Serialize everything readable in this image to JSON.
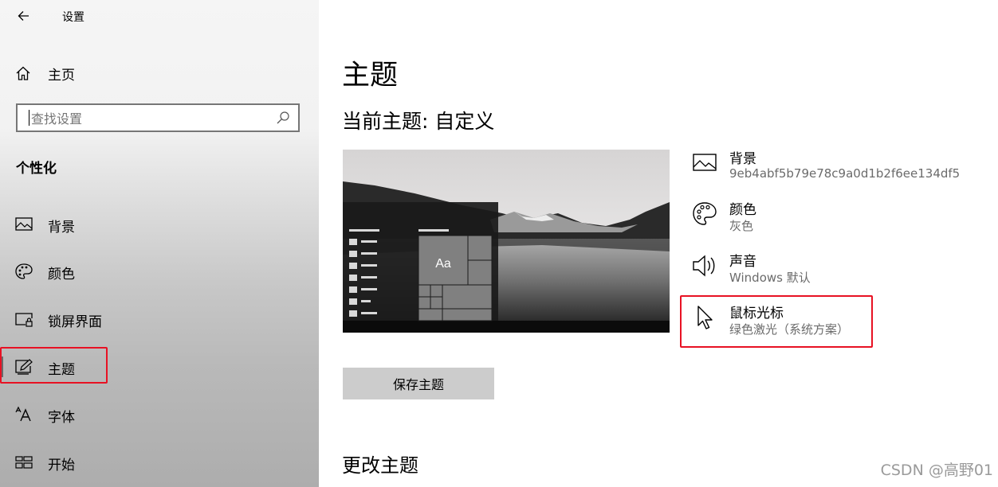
{
  "window": {
    "title": "设置"
  },
  "sidebar": {
    "home_label": "主页",
    "search_placeholder": "查找设置",
    "section_title": "个性化",
    "items": [
      {
        "label": "背景",
        "icon": "picture-icon"
      },
      {
        "label": "颜色",
        "icon": "palette-icon"
      },
      {
        "label": "锁屏界面",
        "icon": "lock-screen-icon"
      },
      {
        "label": "主题",
        "icon": "theme-icon",
        "selected": true
      },
      {
        "label": "字体",
        "icon": "font-icon"
      },
      {
        "label": "开始",
        "icon": "start-icon"
      }
    ]
  },
  "main": {
    "title": "主题",
    "current_theme": "当前主题: 自定义",
    "preview_tile_text": "Aa",
    "options": [
      {
        "title": "背景",
        "value": "9eb4abf5b79e78c9a0d1b2f6ee134df5",
        "icon": "picture-icon"
      },
      {
        "title": "颜色",
        "value": "灰色",
        "icon": "palette-icon"
      },
      {
        "title": "声音",
        "value": "Windows 默认",
        "icon": "speaker-icon"
      },
      {
        "title": "鼠标光标",
        "value": "绿色激光（系统方案）",
        "icon": "cursor-icon"
      }
    ],
    "save_button": "保存主题",
    "change_theme_heading": "更改主题"
  },
  "watermark": "CSDN @高野01",
  "colors": {
    "highlight_red": "#e81123",
    "selected_bar": "#696969"
  }
}
